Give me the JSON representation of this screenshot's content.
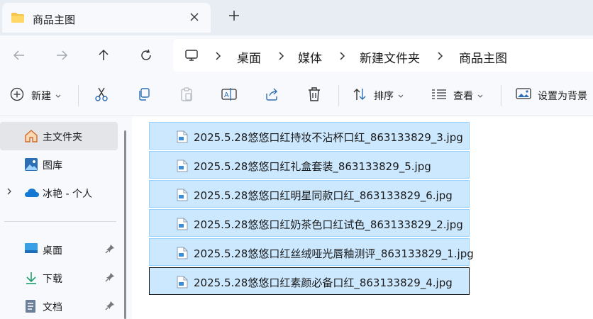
{
  "tab": {
    "title": "商品主图"
  },
  "breadcrumb": [
    "桌面",
    "媒体",
    "新建文件夹",
    "商品主图"
  ],
  "toolbar": {
    "new_label": "新建",
    "sort_label": "排序",
    "view_label": "查看",
    "set_background_label": "设置为背景"
  },
  "sidebar": {
    "items": [
      {
        "label": "主文件夹"
      },
      {
        "label": "图库"
      },
      {
        "label": "冰艳 - 个人"
      }
    ],
    "pinned": [
      {
        "label": "桌面"
      },
      {
        "label": "下载"
      },
      {
        "label": "文档"
      }
    ]
  },
  "files": [
    {
      "name": "2025.5.28悠悠口红持妆不沾杯口红_863133829_3.jpg"
    },
    {
      "name": "2025.5.28悠悠口红礼盒套装_863133829_5.jpg"
    },
    {
      "name": "2025.5.28悠悠口红明星同款口红_863133829_6.jpg"
    },
    {
      "name": "2025.5.28悠悠口红奶茶色口红试色_863133829_2.jpg"
    },
    {
      "name": "2025.5.28悠悠口红丝绒哑光唇釉测评_863133829_1.jpg"
    },
    {
      "name": "2025.5.28悠悠口红素颜必备口红_863133829_4.jpg"
    }
  ],
  "colors": {
    "accent": "#0067c0",
    "selection": "#cce8ff",
    "selection_border": "#99d1ff",
    "folder": "#f4c44c"
  },
  "icons": [
    "folder-icon",
    "close-icon",
    "plus-icon",
    "back-arrow-icon",
    "forward-arrow-icon",
    "up-arrow-icon",
    "refresh-icon",
    "computer-icon",
    "chevron-right-icon",
    "new-icon",
    "cut-icon",
    "copy-icon",
    "paste-icon",
    "rename-icon",
    "share-icon",
    "delete-icon",
    "sort-icon",
    "view-icon",
    "wallpaper-icon",
    "home-icon",
    "gallery-icon",
    "cloud-icon",
    "desktop-icon",
    "download-icon",
    "document-icon",
    "pin-icon",
    "image-file-icon"
  ]
}
